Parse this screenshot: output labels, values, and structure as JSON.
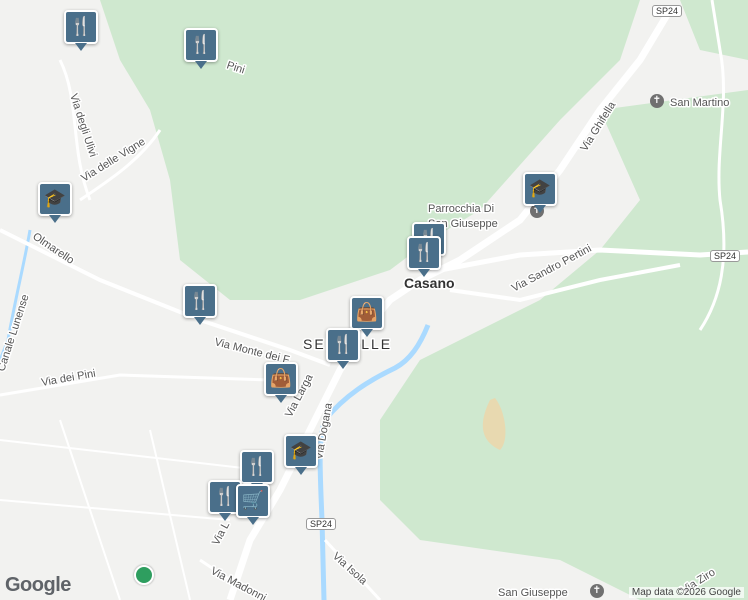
{
  "places": {
    "casano": "Casano",
    "sercalle": "SERCALLE",
    "san_martino": "San Martino",
    "parrocchia_1": "Parrocchia Di",
    "parrocchia_2": "San Giuseppe",
    "san_giuseppe": "San Giuseppe"
  },
  "roads": {
    "via_ghiffella": "Via Ghifella",
    "via_sandro_pertini": "Via Sandro Pertini",
    "via_monte_dei": "Via Monte dei F",
    "via_larga": "Via Larga",
    "via_dogana": "Via Dogana",
    "via_dei_pini": "Via dei Pini",
    "via_degli_ulivi": "Via degli Ulivi",
    "via_delle_vigne": "Via delle Vigne",
    "olmarello": "Olmarello",
    "canale_lunense": "Canale Lunense",
    "via_isola": "Via Isola",
    "via_madonnina": "Via Madonni",
    "via_ziro": "Via Ziro",
    "pini_fragment": "Pini",
    "via_l": "Via L"
  },
  "shields": {
    "sp24_top": "SP24",
    "sp24_right": "SP24",
    "sp24_bottom": "SP24"
  },
  "icons": {
    "restaurant": "🍴",
    "shopping": "👜",
    "school": "🎓",
    "grocery": "🛒",
    "church": "✝"
  },
  "footer": {
    "copyright": "Map data ©2026 Google",
    "logo": "Google"
  },
  "colors": {
    "park_green": "#cfe8cf",
    "road": "#ffffff",
    "water": "#aadaff",
    "poi_marker": "#4a6f8a"
  }
}
